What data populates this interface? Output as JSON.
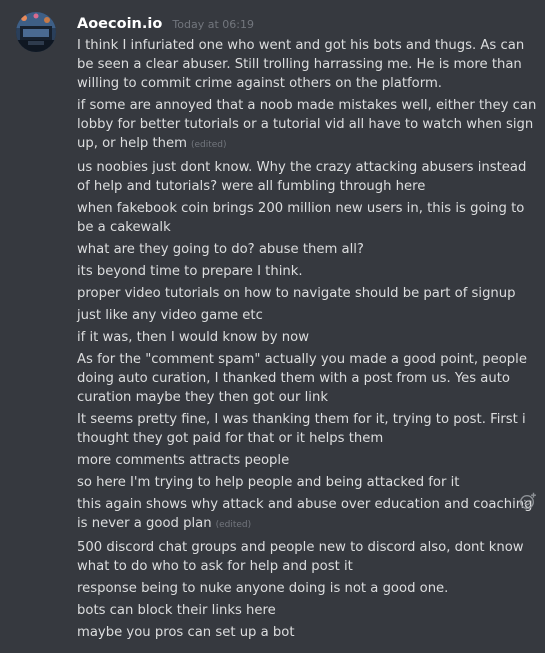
{
  "author": {
    "username": "Aoecoin.io",
    "timestamp": "Today at 06:19"
  },
  "edited_label": "(edited)",
  "messages": [
    {
      "text": "I think I infuriated one who went and got his bots and thugs. As can be seen a clear abuser. Still trolling harrassing me. He is more than willing to commit crime against others on the platform.",
      "edited": false
    },
    {
      "text": "if some are annoyed that a noob made mistakes well, either they can lobby for better tutorials or a tutorial vid all have to watch when sign up, or help them",
      "edited": true
    },
    {
      "text": "us noobies just dont know. Why the crazy attacking abusers instead of help and tutorials? were all fumbling through here",
      "edited": false
    },
    {
      "text": "when fakebook coin brings 200 million new users in, this is going to be a cakewalk",
      "edited": false
    },
    {
      "text": "what are they going to do? abuse them all?",
      "edited": false
    },
    {
      "text": "its beyond time to prepare I think.",
      "edited": false
    },
    {
      "text": "proper video tutorials on how to navigate should be part of signup",
      "edited": false
    },
    {
      "text": "just like any video game etc",
      "edited": false
    },
    {
      "text": "if it was, then I would know by now",
      "edited": false
    },
    {
      "text": "As for the \"comment spam\" actually you made a good point, people doing auto curation, I thanked them with a post from us. Yes auto curation maybe they then got our link",
      "edited": false
    },
    {
      "text": "It seems pretty fine, I was thanking them for it, trying to post. First i thought they got paid for that or it helps them",
      "edited": false
    },
    {
      "text": "more comments attracts people",
      "edited": false
    },
    {
      "text": "so here I'm trying to help people and being attacked for it",
      "edited": false
    },
    {
      "text": "this again shows why attack and abuse over education and coaching is never a good plan",
      "edited": true
    },
    {
      "text": "500 discord chat groups and people new to discord also, dont know what to do who to ask for help and post it",
      "edited": false
    },
    {
      "text": "response being to nuke anyone doing is not a good one.",
      "edited": false
    },
    {
      "text": "bots can block their links here",
      "edited": false
    },
    {
      "text": "maybe you pros can set up a bot",
      "edited": false
    }
  ],
  "icons": {
    "avatar": "avatar-image",
    "reaction": "add-reaction-icon"
  },
  "colors": {
    "background": "#36393f",
    "text": "#dcddde",
    "username": "#ffffff",
    "muted": "#72767d"
  }
}
